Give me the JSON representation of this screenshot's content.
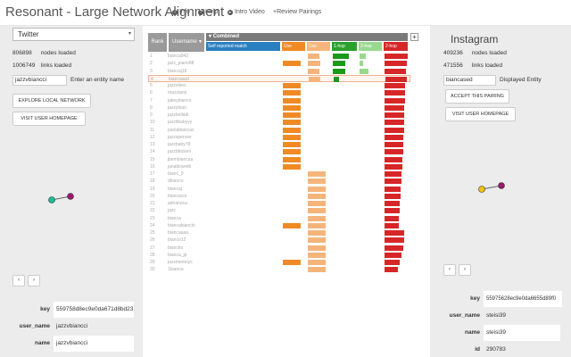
{
  "app": {
    "title": "Resonant - Large Network Alignment",
    "nav": [
      {
        "label": "Info",
        "icon": "info-icon"
      },
      {
        "label": "Help",
        "icon": "help-icon"
      },
      {
        "label": "Intro Video",
        "icon": "video-icon"
      },
      {
        "label": "Review Pairings",
        "icon": "plus-icon"
      }
    ]
  },
  "left": {
    "network_select": "Twitter",
    "nodes_count": "806898",
    "nodes_label": "nodes loaded",
    "links_count": "1006749",
    "links_label": "links loaded",
    "entity_value": "jazzvbiancci",
    "entity_label": "Enter an entity name",
    "explore_button": "EXPLORE LOCAL NETWORK",
    "visit_button": "VISIT USER HOMEPAGE",
    "prev_label": "‹",
    "next_label": "›",
    "details": [
      {
        "key": "key",
        "value": "559758d8ec9e0da671d8bd23"
      },
      {
        "key": "user_name",
        "value": "jazzvbiancci"
      },
      {
        "key": "name",
        "value": "jazzvbiancci"
      }
    ],
    "graph_colors": {
      "a": "#1abc9c",
      "b": "#9b1a6e"
    }
  },
  "right": {
    "network_title": "Instagram",
    "nodes_count": "409236",
    "nodes_label": "nodes loaded",
    "links_count": "471556",
    "links_label": "links loaded",
    "entity_value": "biancased",
    "entity_label": "Displayed Entity",
    "accept_button": "ACCEPT THIS PAIRING",
    "visit_button": "VISIT USER HOMEPAGE",
    "prev_label": "‹",
    "next_label": "›",
    "details": [
      {
        "key": "key",
        "value": "55975628ec9e0da6655d89f0"
      },
      {
        "key": "user_name",
        "value": "steisi39"
      },
      {
        "key": "name",
        "value": "steisi39"
      },
      {
        "key": "id",
        "value": "290783"
      }
    ],
    "graph_colors": {
      "a": "#f1c40f",
      "b": "#9b1a6e"
    }
  },
  "table": {
    "rank_header": "Rank",
    "username_header": "Username",
    "combined_header": "Combined",
    "expand_label": "+",
    "subcolumns": [
      {
        "label": "Self reported match",
        "color": "#2a7fc0"
      },
      {
        "label": "Use",
        "color": "#f08a24"
      },
      {
        "label": "Use",
        "color": "#f5b57a"
      },
      {
        "label": "1-hop",
        "color": "#2ca02c"
      },
      {
        "label": "2-hop",
        "color": "#98d98e"
      },
      {
        "label": "2-hop",
        "color": "#d62728"
      }
    ],
    "rows": [
      {
        "rank": "1",
        "username": "bianca942",
        "v": [
          0,
          0,
          0.65,
          0.9,
          0.35,
          0.95
        ]
      },
      {
        "rank": "2",
        "username": "jazz_piano88",
        "v": [
          0,
          1.0,
          0.7,
          0.7,
          0.2,
          0.92
        ]
      },
      {
        "rank": "3",
        "username": "biancaj18",
        "v": [
          0,
          0,
          0.65,
          0.7,
          0.5,
          0.9
        ]
      },
      {
        "rank": "4",
        "username": "biancased",
        "v": [
          0,
          0,
          0.65,
          0.3,
          0,
          0.88
        ]
      },
      {
        "rank": "5",
        "username": "jazzvibes",
        "v": [
          0,
          1.0,
          0,
          0,
          0,
          0.86
        ]
      },
      {
        "rank": "6",
        "username": "mazziano",
        "v": [
          0,
          1.0,
          0,
          0,
          0,
          0.84
        ]
      },
      {
        "rank": "7",
        "username": "jakeybianco",
        "v": [
          0,
          1.0,
          0,
          0,
          0,
          0.84
        ]
      },
      {
        "rank": "8",
        "username": "jazzybian",
        "v": [
          0,
          1.0,
          0,
          0,
          0,
          0.83
        ]
      },
      {
        "rank": "9",
        "username": "jazzbelladi",
        "v": [
          0,
          1.0,
          0,
          0,
          0,
          0.82
        ]
      },
      {
        "rank": "10",
        "username": "jazzitbabyyy",
        "v": [
          0,
          1.0,
          0,
          0,
          0,
          0.8
        ]
      },
      {
        "rank": "11",
        "username": "paolabiancas",
        "v": [
          0,
          1.0,
          0,
          0,
          0,
          0.8
        ]
      },
      {
        "rank": "12",
        "username": "jazzspencer",
        "v": [
          0,
          1.0,
          0,
          0,
          0,
          0.78
        ]
      },
      {
        "rank": "13",
        "username": "jazzbaby78",
        "v": [
          0,
          1.0,
          0,
          0,
          0,
          0.77
        ]
      },
      {
        "rank": "14",
        "username": "jazzbbiziani",
        "v": [
          0,
          1.0,
          0,
          0,
          0,
          0.76
        ]
      },
      {
        "rank": "15",
        "username": "jbembiancaa",
        "v": [
          0,
          1.0,
          0,
          0,
          0,
          0.74
        ]
      },
      {
        "rank": "16",
        "username": "janabiraretti",
        "v": [
          0,
          1.0,
          0,
          0,
          0,
          0.73
        ]
      },
      {
        "rank": "17",
        "username": "bianc_0",
        "v": [
          0,
          0,
          1.0,
          0,
          0,
          0.7
        ]
      },
      {
        "rank": "18",
        "username": "dbianco",
        "v": [
          0,
          0,
          1.0,
          0,
          0,
          0.7
        ]
      },
      {
        "rank": "19",
        "username": "biancaj",
        "v": [
          0,
          0,
          1.0,
          0,
          0,
          0.68
        ]
      },
      {
        "rank": "20",
        "username": "biancacor",
        "v": [
          0,
          0,
          1.0,
          0,
          0,
          0.66
        ]
      },
      {
        "rank": "21",
        "username": "adrianoca",
        "v": [
          0,
          0,
          1.0,
          0,
          0,
          0.64
        ]
      },
      {
        "rank": "22",
        "username": "jazz",
        "v": [
          0,
          0,
          1.0,
          0,
          0,
          0.62
        ]
      },
      {
        "rank": "23",
        "username": "bianca",
        "v": [
          0,
          0,
          1.0,
          0,
          0,
          0.6
        ]
      },
      {
        "rank": "24",
        "username": "biancabianchi",
        "v": [
          0,
          1.0,
          1.0,
          0,
          0,
          0.58
        ]
      },
      {
        "rank": "25",
        "username": "biancaaaa",
        "v": [
          0,
          0,
          1.0,
          0,
          0,
          0.82
        ]
      },
      {
        "rank": "26",
        "username": "bianco12",
        "v": [
          0,
          0,
          1.0,
          0,
          0,
          0.8
        ]
      },
      {
        "rank": "27",
        "username": "biancks",
        "v": [
          0,
          0,
          1.0,
          0,
          0,
          0.78
        ]
      },
      {
        "rank": "28",
        "username": "bianca_jp",
        "v": [
          0,
          0,
          1.0,
          0,
          0,
          0.72
        ]
      },
      {
        "rank": "29",
        "username": "jazzmemnyc",
        "v": [
          0,
          1.0,
          1.0,
          0,
          0,
          0.62
        ]
      },
      {
        "rank": "30",
        "username": "1bianca",
        "v": [
          0,
          0,
          1.0,
          0,
          0,
          0.55
        ]
      }
    ]
  }
}
